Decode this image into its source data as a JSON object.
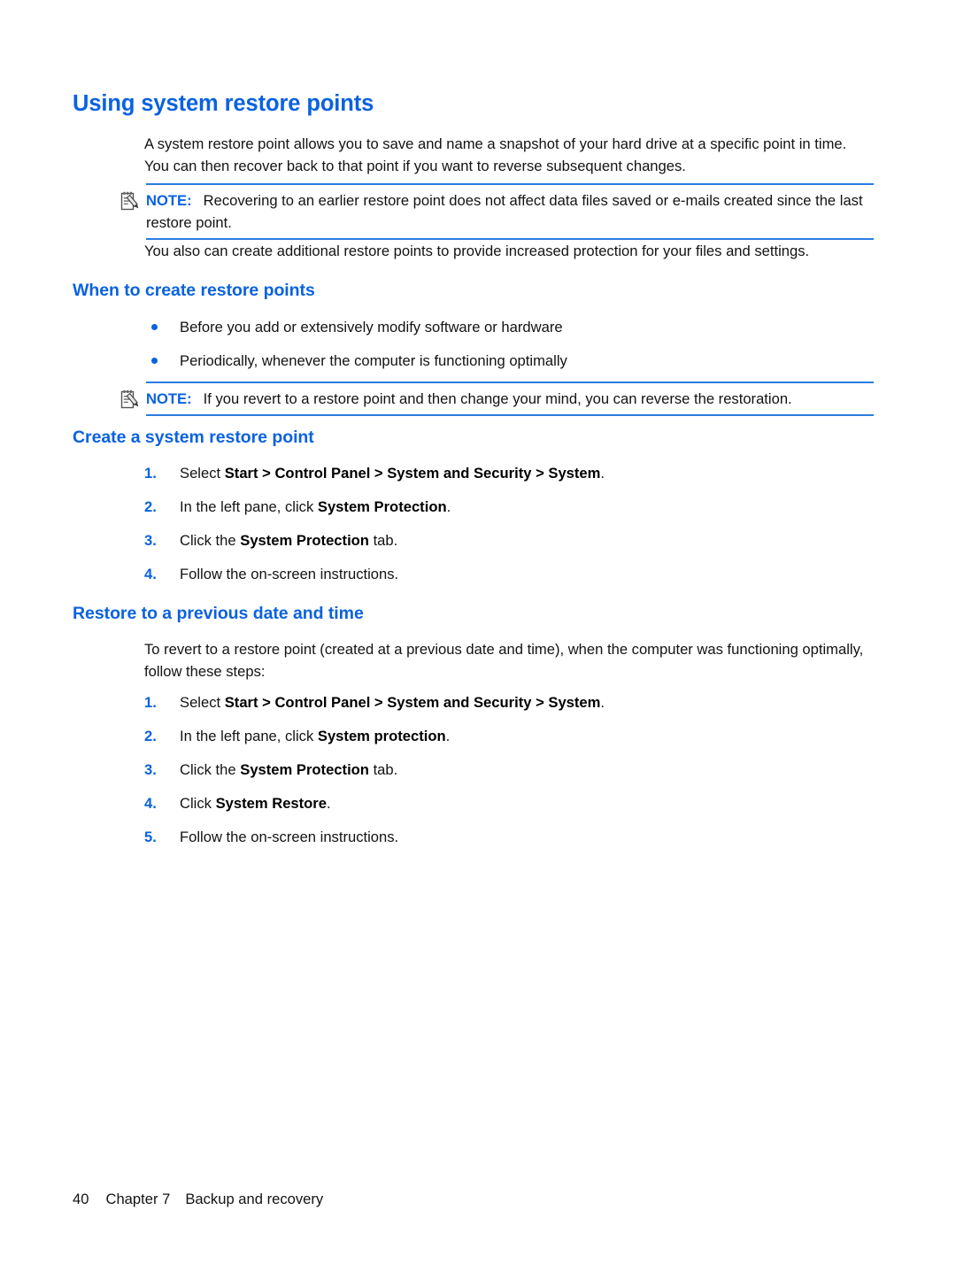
{
  "page": {
    "title": "Using system restore points",
    "accent_color": "#0a62e0",
    "rule_color": "#2a7de1",
    "text_color": "#131313",
    "background_color": "#ffffff"
  },
  "intro_paragraph": "A system restore point allows you to save and name a snapshot of your hard drive at a specific point in time. You can then recover back to that point if you want to reverse subsequent changes.",
  "note_1": {
    "label": "NOTE:",
    "text": "Recovering to an earlier restore point does not affect data files saved or e-mails created since the last restore point.",
    "icon": "note-pencil-icon"
  },
  "also_paragraph": "You also can create additional restore points to provide increased protection for your files and settings.",
  "section_when": {
    "heading": "When to create restore points",
    "bullets": [
      "Before you add or extensively modify software or hardware",
      "Periodically, whenever the computer is functioning optimally"
    ]
  },
  "note_2": {
    "label": "NOTE:",
    "text": "If you revert to a restore point and then change your mind, you can reverse the restoration.",
    "icon": "note-pencil-icon"
  },
  "section_create": {
    "heading": "Create a system restore point",
    "steps": [
      {
        "number": "1.",
        "prefix": "Select ",
        "bold": "Start > Control Panel > System and Security > System",
        "suffix": "."
      },
      {
        "number": "2.",
        "prefix": "In the left pane, click ",
        "bold": "System Protection",
        "suffix": "."
      },
      {
        "number": "3.",
        "prefix": "Click the ",
        "bold": "System Protection",
        "suffix": " tab."
      },
      {
        "number": "4.",
        "prefix": "Follow the on-screen instructions.",
        "bold": "",
        "suffix": ""
      }
    ]
  },
  "section_restore": {
    "heading": "Restore to a previous date and time",
    "intro": "To revert to a restore point (created at a previous date and time), when the computer was functioning optimally, follow these steps:",
    "steps": [
      {
        "number": "1.",
        "prefix": "Select ",
        "bold": "Start > Control Panel > System and Security > System",
        "suffix": "."
      },
      {
        "number": "2.",
        "prefix": "In the left pane, click ",
        "bold": "System protection",
        "suffix": "."
      },
      {
        "number": "3.",
        "prefix": "Click the ",
        "bold": "System Protection",
        "suffix": " tab."
      },
      {
        "number": "4.",
        "prefix": "Click ",
        "bold": "System Restore",
        "suffix": "."
      },
      {
        "number": "5.",
        "prefix": "Follow the on-screen instructions.",
        "bold": "",
        "suffix": ""
      }
    ]
  },
  "footer": {
    "page_number": "40",
    "chapter": "Chapter 7",
    "chapter_title": "Backup and recovery"
  }
}
